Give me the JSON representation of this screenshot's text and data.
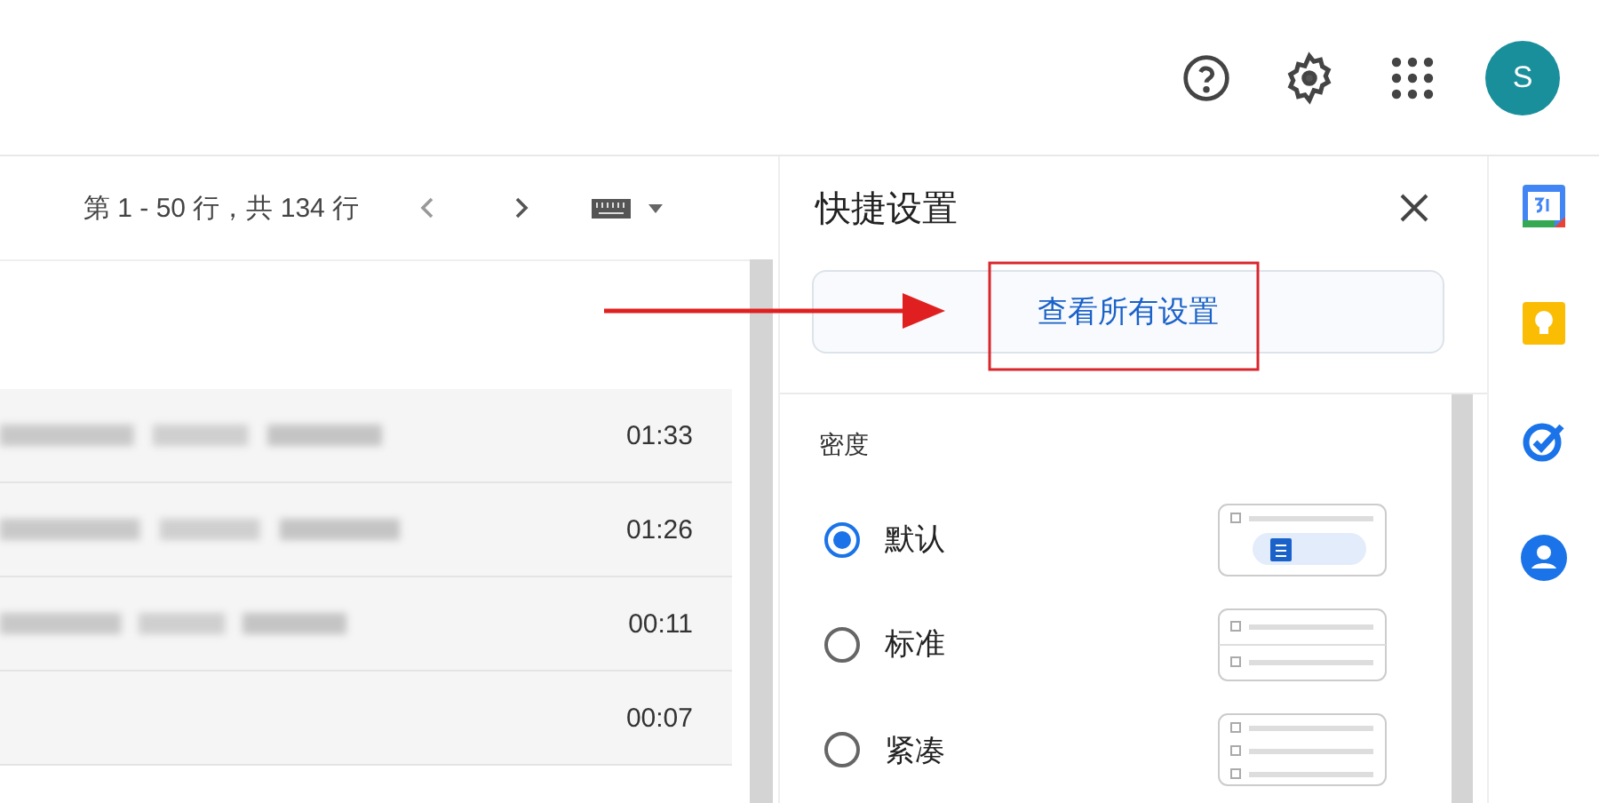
{
  "header": {
    "avatar_letter": "S"
  },
  "toolbar": {
    "pagination": "第 1 - 50 行，共 134 行"
  },
  "emails": [
    {
      "time": "01:33"
    },
    {
      "time": "01:26"
    },
    {
      "time": "00:11"
    },
    {
      "time": "00:07"
    }
  ],
  "quick_settings": {
    "title": "快捷设置",
    "all_settings_button": "查看所有设置",
    "density": {
      "label": "密度",
      "options": [
        {
          "label": "默认",
          "selected": true,
          "kind": "default"
        },
        {
          "label": "标准",
          "selected": false,
          "kind": "comfortable"
        },
        {
          "label": "紧凑",
          "selected": false,
          "kind": "compact"
        }
      ]
    }
  }
}
